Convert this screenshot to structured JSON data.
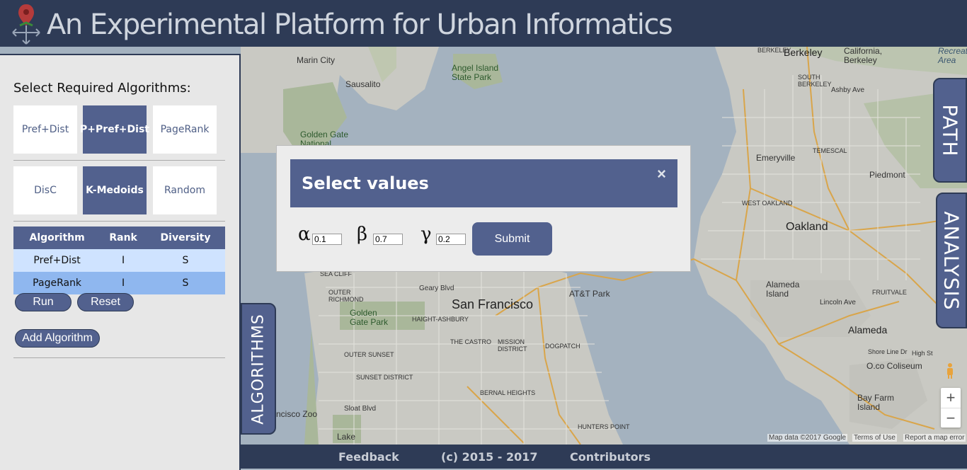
{
  "header": {
    "title": "An Experimental Platform for Urban Informatics"
  },
  "panel": {
    "heading": "Select Required Algorithms:",
    "algorithms_row1": [
      "Pref+Dist",
      "P+Pref+Dist",
      "PageRank"
    ],
    "algorithms_row2": [
      "DisC",
      "K-Medoids",
      "Random"
    ],
    "selected": [
      "P+Pref+Dist",
      "K-Medoids"
    ],
    "table": {
      "headers": [
        "Algorithm",
        "Rank",
        "Diversity"
      ],
      "rows": [
        [
          "Pref+Dist",
          "I",
          "S"
        ],
        [
          "PageRank",
          "I",
          "S"
        ]
      ]
    },
    "run_label": "Run",
    "reset_label": "Reset",
    "add_label": "Add Algorithm"
  },
  "tabs": {
    "path": "PATH",
    "analysis": "ANALYSIS",
    "algorithms": "ALGORITHMS"
  },
  "modal": {
    "title": "Select values",
    "close": "×",
    "alpha_symbol": "α",
    "alpha_value": "0.1",
    "beta_symbol": "β",
    "beta_value": "0.7",
    "gamma_symbol": "γ",
    "gamma_value": "0.2",
    "submit_label": "Submit"
  },
  "footer": {
    "feedback": "Feedback",
    "copyright": "(c) 2015 - 2017",
    "contributors": "Contributors"
  },
  "map": {
    "labels": {
      "berkeley": "Berkeley",
      "california_berkeley": "California,\nBerkeley",
      "berkeley_small": "BERKELEY",
      "marin_city": "Marin City",
      "sausalito": "Sausalito",
      "angel_island": "Angel Island\nState Park",
      "golden_gate": "Golden Gate\nNational",
      "emeryville": "Emeryville",
      "piedmont": "Piedmont",
      "west_oakland": "WEST OAKLAND",
      "oakland": "Oakland",
      "alameda_island": "Alameda\nIsland",
      "alameda": "Alameda",
      "san_francisco": "San Francisco",
      "att_park": "AT&T Park",
      "golden_gate_park": "Golden\nGate Park",
      "outer_richmond": "OUTER\nRICHMOND",
      "sea_cliff": "SEA CLIFF",
      "geary_blvd": "Geary Blvd",
      "haight": "HAIGHT-ASHBURY",
      "castro": "THE CASTRO",
      "mission": "MISSION\nDISTRICT",
      "dogpatch": "DOGPATCH",
      "outer_sunset": "OUTER SUNSET",
      "sunset": "SUNSET DISTRICT",
      "bernal": "BERNAL HEIGHTS",
      "hunters_point": "HUNTERS POINT",
      "sloat": "Sloat Blvd",
      "ncisco_zoo": "ncisco Zoo",
      "lake": "Lake",
      "bay_farm": "Bay Farm\nIsland",
      "coliseum": "O.co Coliseum",
      "fruitvale": "FRUITVALE",
      "south_berkeley": "SOUTH\nBERKELEY",
      "temescal": "TEMESCAL",
      "ashby": "Ashby Ave",
      "recreation": "Recreation\nArea",
      "shore_line": "Shore Line Dr",
      "high_st": "High St",
      "lincoln_ave": "Lincoln Ave"
    },
    "attribution": {
      "data": "Map data ©2017 Google",
      "terms": "Terms of Use",
      "report": "Report a map error"
    },
    "zoom_in": "+",
    "zoom_out": "−"
  }
}
